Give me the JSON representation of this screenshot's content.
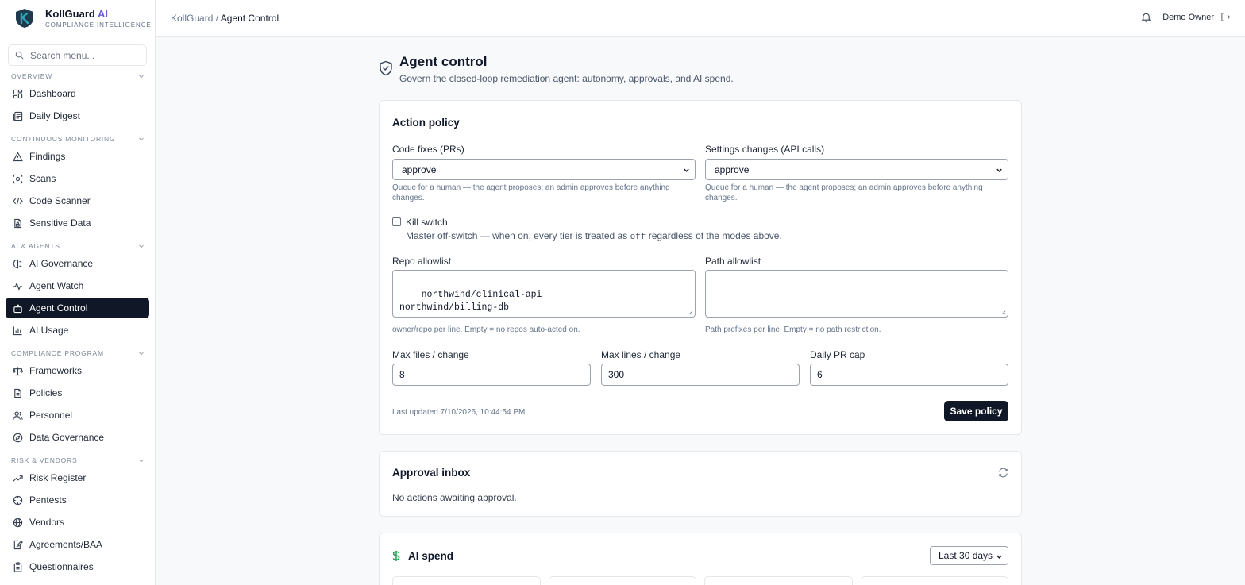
{
  "brand": {
    "name": "KollGuard",
    "ai": "AI",
    "subtitle": "COMPLIANCE INTELLIGENCE"
  },
  "sidebar": {
    "search_placeholder": "Search menu...",
    "sections": [
      {
        "title": "OVERVIEW",
        "items": [
          {
            "label": "Dashboard",
            "icon": "dashboard-icon"
          },
          {
            "label": "Daily Digest",
            "icon": "newspaper-icon"
          }
        ]
      },
      {
        "title": "CONTINUOUS MONITORING",
        "items": [
          {
            "label": "Findings",
            "icon": "warning-triangle-icon"
          },
          {
            "label": "Scans",
            "icon": "scan-icon"
          },
          {
            "label": "Code Scanner",
            "icon": "code-icon"
          },
          {
            "label": "Sensitive Data",
            "icon": "file-lock-icon"
          }
        ]
      },
      {
        "title": "AI & AGENTS",
        "items": [
          {
            "label": "AI Governance",
            "icon": "brain-icon"
          },
          {
            "label": "Agent Watch",
            "icon": "activity-icon"
          },
          {
            "label": "Agent Control",
            "icon": "bot-icon",
            "active": true
          },
          {
            "label": "AI Usage",
            "icon": "bar-chart-icon"
          }
        ]
      },
      {
        "title": "COMPLIANCE PROGRAM",
        "items": [
          {
            "label": "Frameworks",
            "icon": "scale-icon"
          },
          {
            "label": "Policies",
            "icon": "document-icon"
          },
          {
            "label": "Personnel",
            "icon": "users-icon"
          },
          {
            "label": "Data Governance",
            "icon": "compass-icon"
          }
        ]
      },
      {
        "title": "RISK & VENDORS",
        "items": [
          {
            "label": "Risk Register",
            "icon": "trending-up-icon"
          },
          {
            "label": "Pentests",
            "icon": "crosshair-icon"
          },
          {
            "label": "Vendors",
            "icon": "globe-icon"
          },
          {
            "label": "Agreements/BAA",
            "icon": "file-signature-icon"
          },
          {
            "label": "Questionnaires",
            "icon": "clipboard-icon"
          }
        ]
      }
    ]
  },
  "topbar": {
    "breadcrumb_root": "KollGuard",
    "breadcrumb_sep": "/",
    "breadcrumb_current": "Agent Control",
    "user_name": "Demo Owner"
  },
  "page": {
    "title": "Agent control",
    "subtitle": "Govern the closed-loop remediation agent: autonomy, approvals, and AI spend."
  },
  "action_policy": {
    "title": "Action policy",
    "code_fixes": {
      "label": "Code fixes (PRs)",
      "value": "approve",
      "help": "Queue for a human — the agent proposes; an admin approves before anything changes."
    },
    "settings_changes": {
      "label": "Settings changes (API calls)",
      "value": "approve",
      "help": "Queue for a human — the agent proposes; an admin approves before anything changes."
    },
    "kill_switch": {
      "label": "Kill switch",
      "help_before": "Master off-switch — when on, every tier is treated as ",
      "help_code": "off",
      "help_after": " regardless of the modes above.",
      "checked": false
    },
    "repo_allowlist": {
      "label": "Repo allowlist",
      "value": "northwind/clinical-api\nnorthwind/billing-db",
      "help": "owner/repo per line. Empty = no repos auto-acted on."
    },
    "path_allowlist": {
      "label": "Path allowlist",
      "value": "",
      "help": "Path prefixes per line. Empty = no path restriction."
    },
    "max_files": {
      "label": "Max files / change",
      "value": "8"
    },
    "max_lines": {
      "label": "Max lines / change",
      "value": "300"
    },
    "daily_pr_cap": {
      "label": "Daily PR cap",
      "value": "6"
    },
    "last_updated": "Last updated 7/10/2026, 10:44:54 PM",
    "save_label": "Save policy"
  },
  "approval_inbox": {
    "title": "Approval inbox",
    "empty_text": "No actions awaiting approval."
  },
  "ai_spend": {
    "title": "AI spend",
    "range": "Last 30 days",
    "accent": "#16a34a"
  },
  "colors": {
    "sidebar_active_bg": "#101828",
    "brand_ai": "#6d5fd8",
    "logo_teal": "#2aa7b8"
  }
}
